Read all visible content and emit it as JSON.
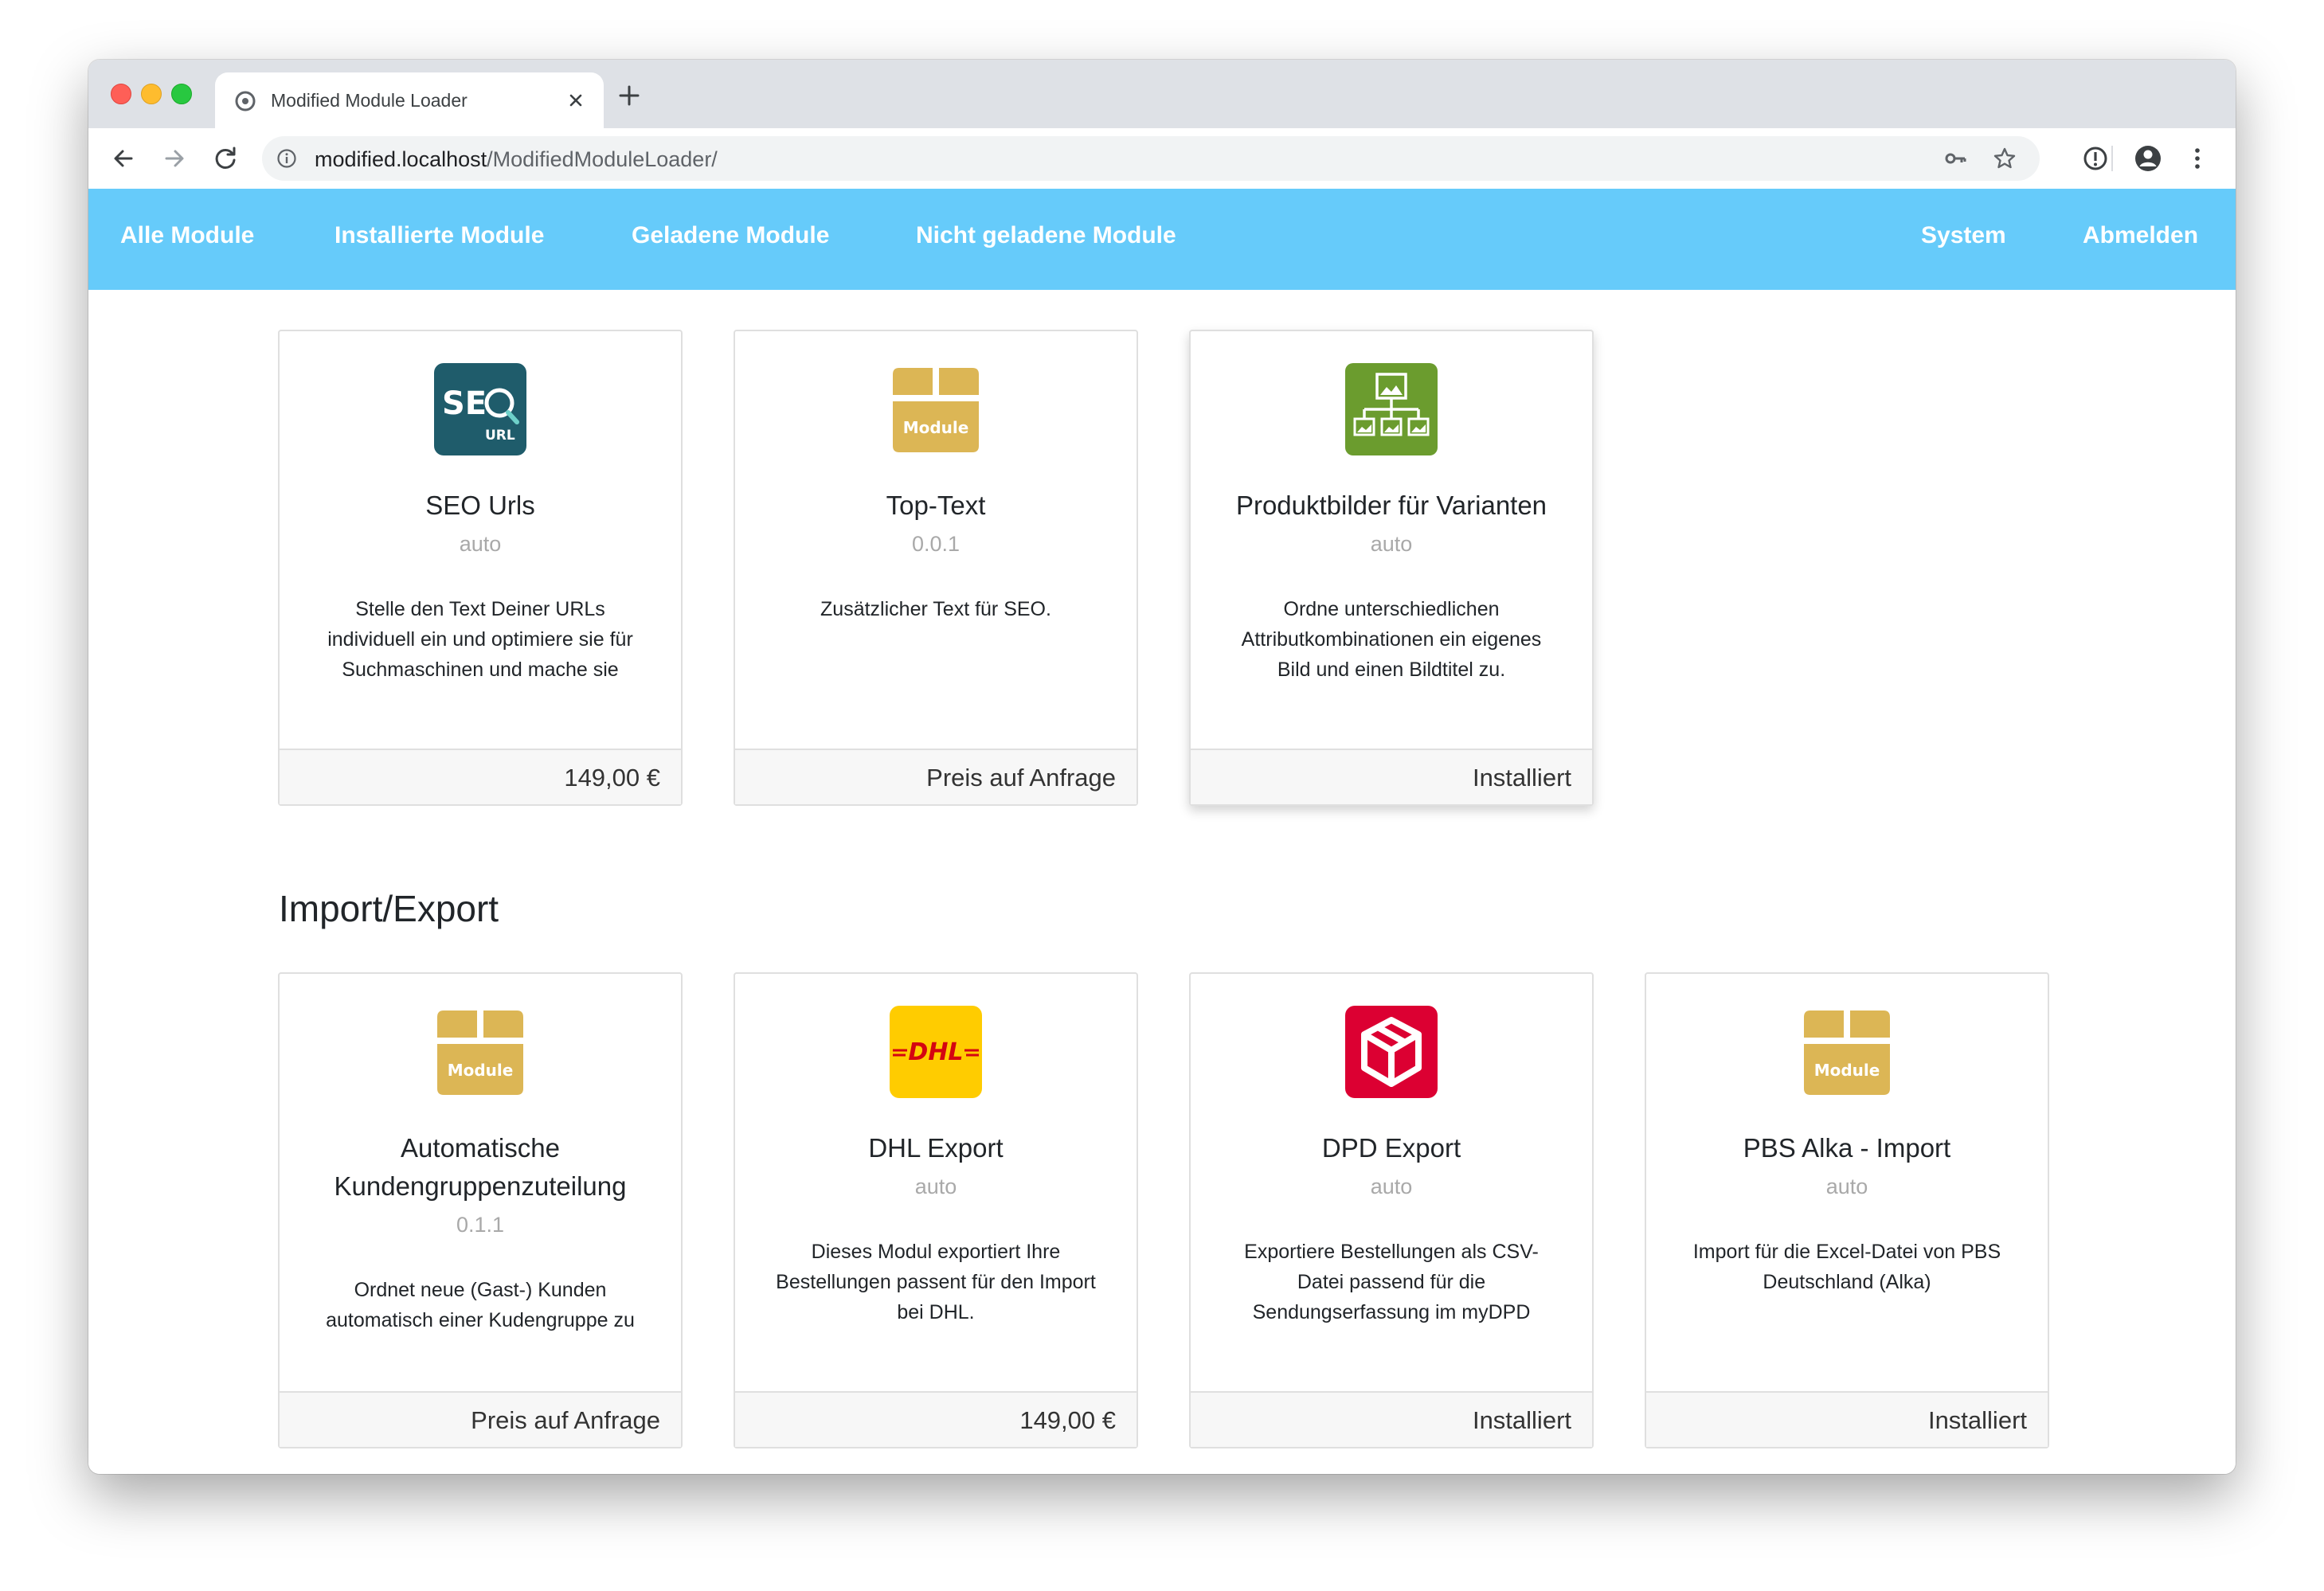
{
  "browser": {
    "tab_title": "Modified Module Loader",
    "url_host": "modified.localhost",
    "url_path": "/ModifiedModuleLoader/"
  },
  "nav": {
    "left": [
      "Alle Module",
      "Installierte Module",
      "Geladene Module",
      "Nicht geladene Module"
    ],
    "right": [
      "System",
      "Abmelden"
    ]
  },
  "colors": {
    "nav_bg": "#66cbfa",
    "seo_icon": "#1f5c6b",
    "module_icon": "#dcb655",
    "variant_icon": "#6b9c2e",
    "dhl_icon": "#ffcc00",
    "dpd_icon": "#dc0032"
  },
  "section1": {
    "cards": [
      {
        "icon": "seo-url-icon",
        "title": "SEO Urls",
        "version": "auto",
        "description": "Stelle den Text Deiner URLs individuell ein und optimiere sie für Suchmaschinen und mache sie",
        "footer": "149,00 €"
      },
      {
        "icon": "module-box-icon",
        "title": "Top-Text",
        "version": "0.0.1",
        "description": "Zusätzlicher Text für SEO.",
        "footer": "Preis auf Anfrage"
      },
      {
        "icon": "product-variant-images-icon",
        "title": "Produktbilder für Varianten",
        "version": "auto",
        "description": "Ordne unterschiedlichen Attributkombinationen ein eigenes Bild und einen Bildtitel zu.",
        "footer": "Installiert"
      }
    ]
  },
  "section2": {
    "title": "Import/Export",
    "cards": [
      {
        "icon": "module-box-icon",
        "title": "Automatische Kundengruppenzuteilung",
        "version": "0.1.1",
        "description": "Ordnet neue (Gast-) Kunden automatisch einer Kudengruppe zu",
        "footer": "Preis auf Anfrage"
      },
      {
        "icon": "dhl-logo-icon",
        "title": "DHL Export",
        "version": "auto",
        "description": "Dieses Modul exportiert Ihre Bestellungen passent für den Import bei DHL.",
        "footer": "149,00 €"
      },
      {
        "icon": "dpd-logo-icon",
        "title": "DPD Export",
        "version": "auto",
        "description": "Exportiere Bestellungen als CSV-Datei passend für die Sendungserfassung im myDPD",
        "footer": "Installiert"
      },
      {
        "icon": "module-box-icon",
        "title": "PBS Alka - Import",
        "version": "auto",
        "description": "Import für die Excel-Datei von PBS Deutschland (Alka)",
        "footer": "Installiert"
      }
    ]
  },
  "icon_text": {
    "module": "Module",
    "seo": "SE",
    "seo_sub": "URL",
    "dhl": "DHL"
  }
}
